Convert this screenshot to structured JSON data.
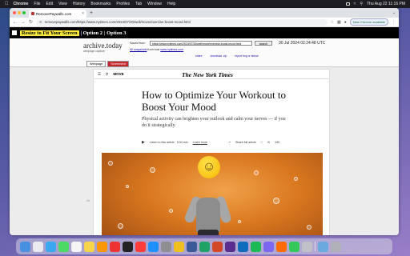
{
  "menubar": {
    "app_name": "Chrome",
    "menus": [
      "File",
      "Edit",
      "View",
      "History",
      "Bookmarks",
      "Profiles",
      "Tab",
      "Window",
      "Help"
    ],
    "datetime": "Thu Aug 22  11:16 PM"
  },
  "browser": {
    "tab_title": "RemovePaywalls.com",
    "url": "removepaywalls.com/https://www.nytimes.com/2024/07/30/well/move/exercise-boost-mood.html",
    "update_label": "New Chrome available"
  },
  "fitbar": {
    "main_label": "Resize to Fit Your Screen",
    "option2": "| Option 2",
    "option3": "| Option 3"
  },
  "archive": {
    "logo": "archive.today",
    "logo_sub": "webpage capture",
    "saved_from_label": "Saved from",
    "saved_url": "https://www.nytimes.com/2024/07/30/well/move/exercise-boost-mood.html",
    "search_btn": "search",
    "date": "30 Jul 2024 02:24:48 UTC",
    "snapshot_text": "All snapshots",
    "snapshot_from": "from host",
    "snapshot_host": "www.nytimes.com",
    "link_share": "share",
    "link_download": "download .zip",
    "link_report": "report bug or abuse",
    "tab_webpage": "Webpage",
    "tab_screenshot": "Screenshot"
  },
  "article": {
    "section": "MOVE",
    "masthead": "The New York Times",
    "headline": "How to Optimize Your Workout to Boost Your Mood",
    "dek": "Physical activity can brighten your outlook and calm your nerves — if you do it strategically.",
    "listen": "Listen to this article · 5:34 min",
    "learn_more": "Learn more",
    "share_full": "Share full article",
    "comments": "130"
  },
  "page_number": "26"
}
